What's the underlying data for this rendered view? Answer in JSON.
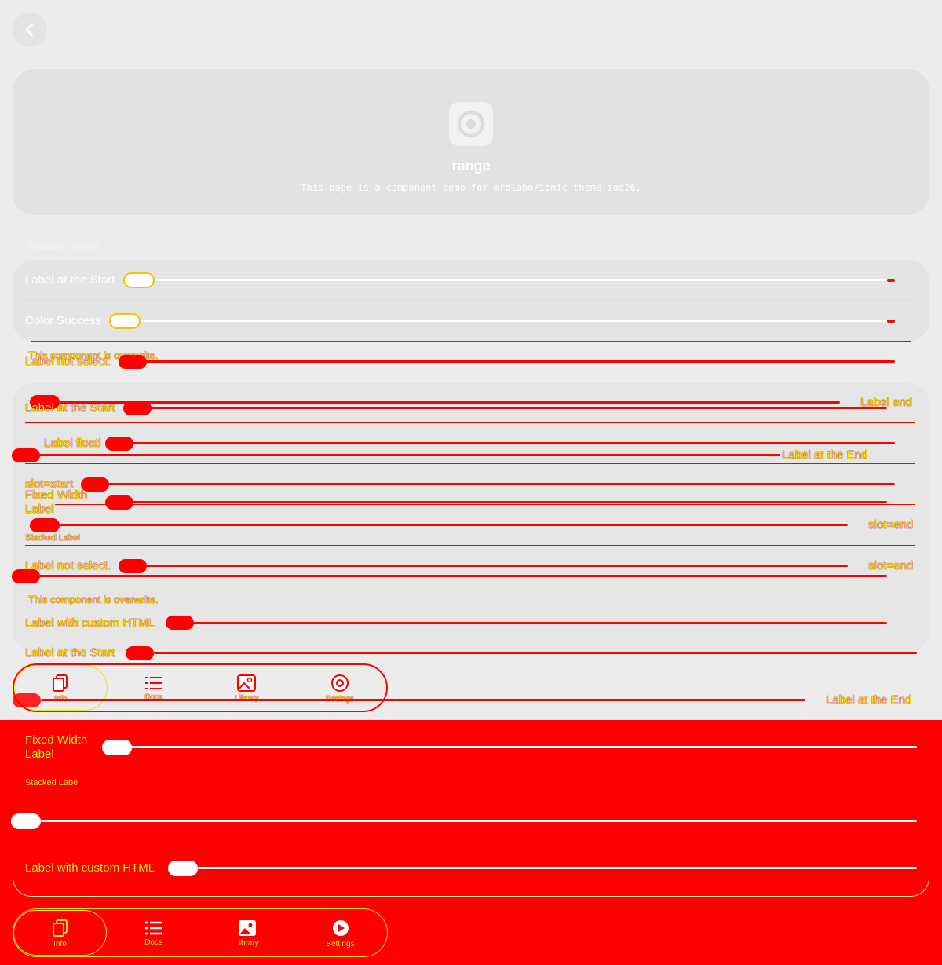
{
  "app": {
    "title": "range",
    "subtitle": "This page is a component demo for @rdlabo/ionic-theme-ios26."
  },
  "section": {
    "default_styles": "Default styles"
  },
  "rows": {
    "label_start": "Label at the Start",
    "color_success": "Color Success",
    "overwrite_note": "This component is overwrite.",
    "label_not_select": "Label not select.",
    "label_end_short": "Label end",
    "label_floating": "Label floati",
    "label_at_end": "Label at the End",
    "slot_start": "slot=start",
    "fixed_width": "Fixed Width",
    "label_word": "Label",
    "slot_end": "slot=end",
    "stacked_label": "Stacked Label",
    "custom_html": "Label with custom HTML"
  },
  "tabs": [
    {
      "label": "Info",
      "icon": "copy-icon"
    },
    {
      "label": "Docs",
      "icon": "list-icon"
    },
    {
      "label": "Library",
      "icon": "image-icon"
    },
    {
      "label": "Settings",
      "icon": "settings-icon"
    }
  ],
  "colors": {
    "accent_red": "#ff0000",
    "outline_yellow": "#f4e300",
    "background": "#ececec"
  }
}
